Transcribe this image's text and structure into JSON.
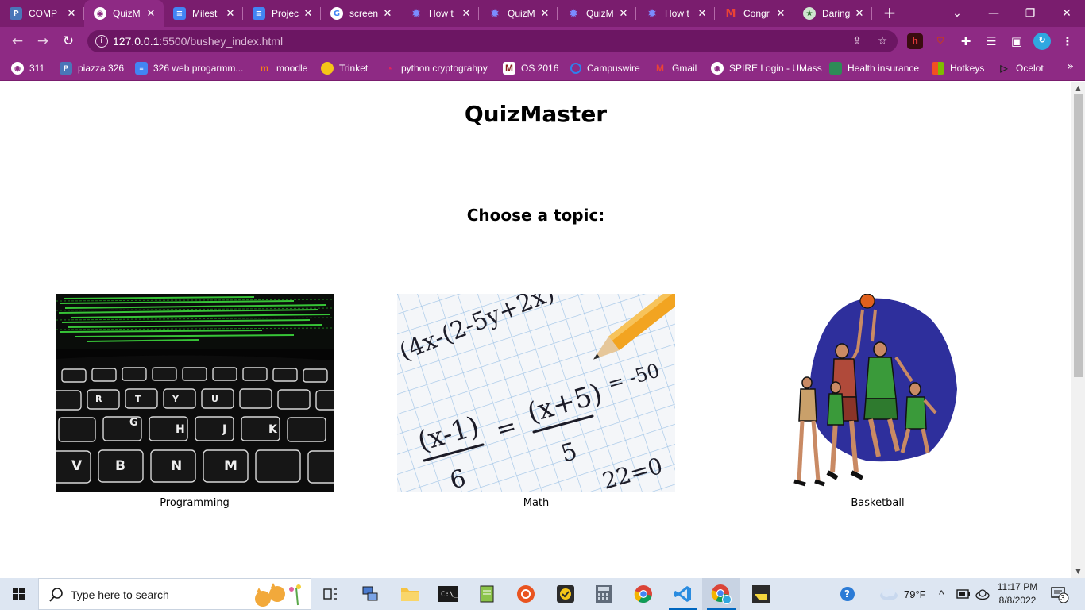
{
  "browser": {
    "tabs": [
      {
        "title": "COMP",
        "icon": "piazza-icon",
        "active": false
      },
      {
        "title": "QuizM",
        "icon": "globe-icon",
        "active": true
      },
      {
        "title": "Milest",
        "icon": "docs-icon",
        "active": false
      },
      {
        "title": "Projec",
        "icon": "docs-icon",
        "active": false
      },
      {
        "title": "screen",
        "icon": "google-icon",
        "active": false
      },
      {
        "title": "How t",
        "icon": "gear-flower-icon",
        "active": false
      },
      {
        "title": "QuizM",
        "icon": "gear-flower-icon",
        "active": false
      },
      {
        "title": "QuizM",
        "icon": "gear-flower-icon",
        "active": false
      },
      {
        "title": "How t",
        "icon": "gear-flower-icon",
        "active": false
      },
      {
        "title": "Congr",
        "icon": "gmail-icon",
        "active": false
      },
      {
        "title": "Daring",
        "icon": "star-icon",
        "active": false
      }
    ],
    "address": {
      "host": "127.0.0.1",
      "path": ":5500/bushey_index.html"
    },
    "bookmarks": [
      {
        "label": "311",
        "icon": "globe-icon",
        "color": "#ffffff"
      },
      {
        "label": "piazza 326",
        "icon": "piazza-icon",
        "color": "#4a76b8"
      },
      {
        "label": "326 web progarmm...",
        "icon": "docs-icon",
        "color": "#4285f4"
      },
      {
        "label": "moodle",
        "icon": "moodle-icon",
        "color": "#f98012"
      },
      {
        "label": "Trinket",
        "icon": "trinket-icon",
        "color": "#f5c518"
      },
      {
        "label": "python cryptograhpy",
        "icon": "pin-icon",
        "color": "#e0245e"
      },
      {
        "label": "OS 2016",
        "icon": "umass-m-icon",
        "color": "#881c1c"
      },
      {
        "label": "Campuswire",
        "icon": "campuswire-icon",
        "color": "#2f80ed"
      },
      {
        "label": "Gmail",
        "icon": "gmail-icon",
        "color": "#ea4335"
      },
      {
        "label": "SPIRE Login - UMass",
        "icon": "globe-icon",
        "color": "#ffffff"
      },
      {
        "label": "Health insurance",
        "icon": "health-icon",
        "color": "#2e8b57"
      },
      {
        "label": "Hotkeys",
        "icon": "windows-color-icon",
        "color": "#f25022"
      },
      {
        "label": "Ocelot",
        "icon": "ocelot-icon",
        "color": "#222222"
      }
    ]
  },
  "page": {
    "title": "QuizMaster",
    "subtitle": "Choose a topic:",
    "topics": [
      {
        "caption": "Programming",
        "image": "keyboard-code-image"
      },
      {
        "caption": "Math",
        "image": "math-paper-image"
      },
      {
        "caption": "Basketball",
        "image": "basketball-players-image"
      }
    ]
  },
  "taskbar": {
    "search_placeholder": "Type here to search",
    "weather": "79°F",
    "time": "11:17 PM",
    "date": "8/8/2022",
    "notifications": "3"
  },
  "colors": {
    "chrome_frame": "#7a1d6e",
    "chrome_toolbar": "#8e2a84",
    "omnibox": "#6c1663",
    "taskbar": "#dde6f2",
    "accent": "#0067c0"
  }
}
